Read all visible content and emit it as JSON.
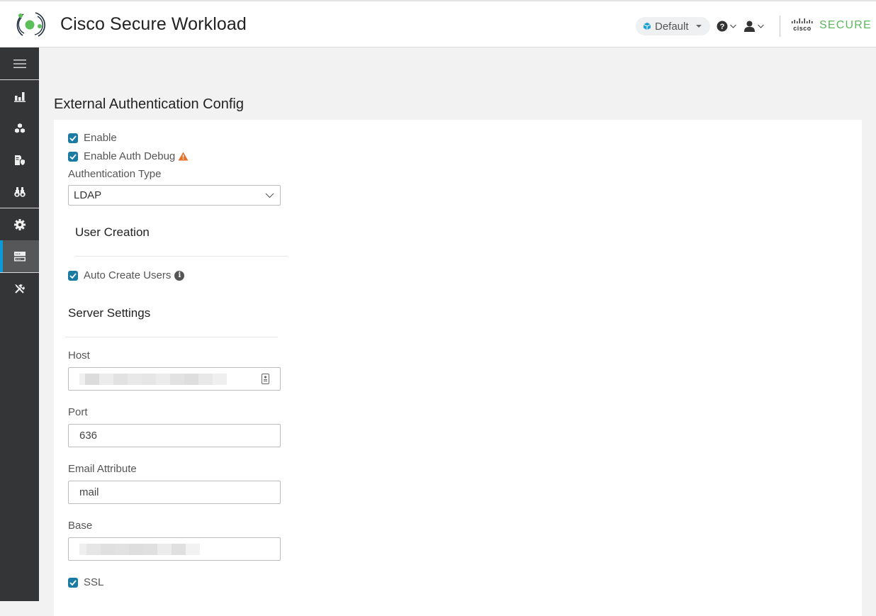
{
  "header": {
    "app_title": "Cisco Secure Workload",
    "scope_label": "Default",
    "help_icon": "question-circle-icon",
    "user_icon": "user-icon",
    "brand_cisco": "cisco",
    "brand_secure": "SECURE"
  },
  "sidebar": {
    "items": [
      {
        "icon": "menu-icon",
        "label": "Menu"
      },
      {
        "icon": "bar-chart-icon",
        "label": "Overview"
      },
      {
        "icon": "cubes-icon",
        "label": "Organize"
      },
      {
        "icon": "policy-shield-icon",
        "label": "Defend"
      },
      {
        "icon": "binoculars-icon",
        "label": "Investigate"
      },
      {
        "icon": "gear-icon",
        "label": "Manage"
      },
      {
        "icon": "server-icon",
        "label": "Platform",
        "active": true
      },
      {
        "icon": "tools-icon",
        "label": "Troubleshoot"
      }
    ]
  },
  "page": {
    "title": "External Authentication Config"
  },
  "form": {
    "enable": {
      "label": "Enable",
      "checked": true
    },
    "auth_debug": {
      "label": "Enable Auth Debug",
      "checked": true,
      "icon": "warning-icon"
    },
    "auth_type": {
      "label": "Authentication Type",
      "value": "LDAP"
    },
    "user_creation": {
      "title": "User Creation",
      "auto_create": {
        "label": "Auto Create Users",
        "checked": true,
        "icon": "info-icon",
        "info_glyph": "i"
      }
    },
    "server_settings": {
      "title": "Server Settings",
      "host": {
        "label": "Host",
        "value": "[redacted]"
      },
      "port": {
        "label": "Port",
        "value": "636"
      },
      "email_attribute": {
        "label": "Email Attribute",
        "value": "mail"
      },
      "base": {
        "label": "Base",
        "value": "[redacted]"
      },
      "ssl": {
        "label": "SSL",
        "checked": true
      }
    }
  },
  "colors": {
    "accent_blue": "#0d98d6",
    "checkbox": "#1c7ba3",
    "brand_green": "#5cb85c",
    "warning_orange": "#e8702a",
    "sidebar_bg": "#333537"
  }
}
